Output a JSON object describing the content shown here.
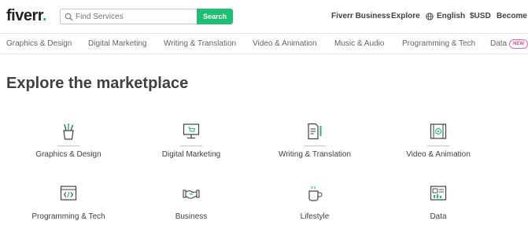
{
  "header": {
    "logo_text": "fiverr",
    "logo_dot": ".",
    "search": {
      "placeholder": "Find Services",
      "value": "",
      "button_label": "Search"
    },
    "nav": {
      "fiverr_business": "Fiverr Business",
      "explore": "Explore",
      "language": "English",
      "currency": "$USD",
      "become_seller": "Become a"
    }
  },
  "categories": {
    "items": [
      "Graphics & Design",
      "Digital Marketing",
      "Writing & Translation",
      "Video & Animation",
      "Music & Audio",
      "Programming & Tech",
      "Data"
    ],
    "new_badge": "NEW"
  },
  "main": {
    "title": "Explore the marketplace",
    "tiles": [
      {
        "label": "Graphics & Design",
        "icon": "graphics-design-icon"
      },
      {
        "label": "Digital Marketing",
        "icon": "digital-marketing-icon"
      },
      {
        "label": "Writing & Translation",
        "icon": "writing-translation-icon"
      },
      {
        "label": "Video & Animation",
        "icon": "video-animation-icon"
      },
      {
        "label": "Programming & Tech",
        "icon": "programming-tech-icon"
      },
      {
        "label": "Business",
        "icon": "business-icon"
      },
      {
        "label": "Lifestyle",
        "icon": "lifestyle-icon"
      },
      {
        "label": "Data",
        "icon": "data-icon"
      }
    ]
  },
  "colors": {
    "brand_green": "#1dbf73",
    "text_dark": "#404145",
    "text_muted": "#62646a",
    "new_badge": "#d04fa1"
  }
}
